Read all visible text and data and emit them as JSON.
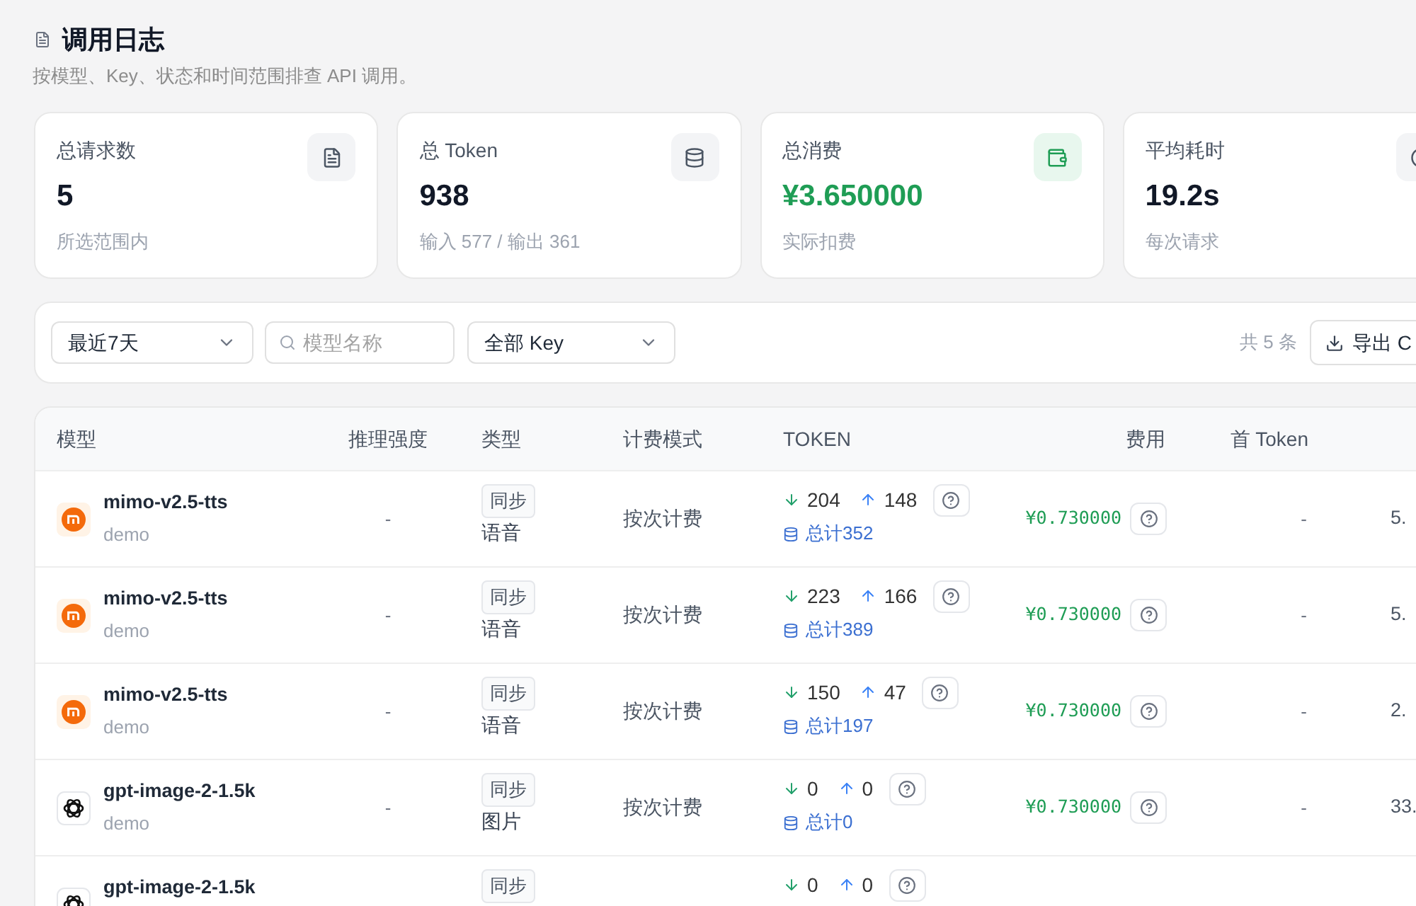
{
  "page": {
    "title": "调用日志",
    "subtitle": "按模型、Key、状态和时间范围排查 API 调用。"
  },
  "stats": [
    {
      "kind": "count",
      "label": "总请求数",
      "value": "5",
      "note": "所选范围内"
    },
    {
      "kind": "tokens",
      "label": "总 Token",
      "value": "938",
      "note": "输入 577 / 输出 361"
    },
    {
      "kind": "cost",
      "label": "总消费",
      "value": "¥3.650000",
      "note": "实际扣费"
    },
    {
      "kind": "time",
      "label": "平均耗时",
      "value": "19.2s",
      "note": "每次请求"
    }
  ],
  "filters": {
    "range": {
      "value": "最近7天"
    },
    "search": {
      "placeholder": "模型名称"
    },
    "key": {
      "value": "全部 Key"
    },
    "count": "共 5 条",
    "export_button": "导出 C"
  },
  "table": {
    "columns": [
      "模型",
      "推理强度",
      "类型",
      "计费模式",
      "TOKEN",
      "费用",
      "首 Token"
    ],
    "rows": [
      {
        "kind": "round",
        "model": "mimo-v2.5-tts",
        "group": "demo",
        "effort": "-",
        "mode": "同步",
        "type": "语音",
        "billing": "按次计费",
        "tokens_in": "204",
        "tokens_out": "148",
        "total": "总计352",
        "cost": "¥0.730000",
        "first_token": "-",
        "column_8": "5."
      },
      {
        "kind": "round",
        "model": "mimo-v2.5-tts",
        "group": "demo",
        "effort": "-",
        "mode": "同步",
        "type": "语音",
        "billing": "按次计费",
        "tokens_in": "223",
        "tokens_out": "166",
        "total": "总计389",
        "cost": "¥0.730000",
        "first_token": "-",
        "column_8": "5."
      },
      {
        "kind": "round",
        "model": "mimo-v2.5-tts",
        "group": "demo",
        "effort": "-",
        "mode": "同步",
        "type": "语音",
        "billing": "按次计费",
        "tokens_in": "150",
        "tokens_out": "47",
        "total": "总计197",
        "cost": "¥0.730000",
        "first_token": "-",
        "column_8": "2."
      },
      {
        "kind": "knot",
        "model": "gpt-image-2-1.5k",
        "group": "demo",
        "effort": "-",
        "mode": "同步",
        "type": "图片",
        "billing": "按次计费",
        "tokens_in": "0",
        "tokens_out": "0",
        "total": "总计0",
        "cost": "¥0.730000",
        "first_token": "-",
        "column_8": "33."
      },
      {
        "kind": "knot",
        "model": "gpt-image-2-1.5k",
        "mode": "同步",
        "tokens_in": "0",
        "tokens_out": "0"
      }
    ]
  }
}
